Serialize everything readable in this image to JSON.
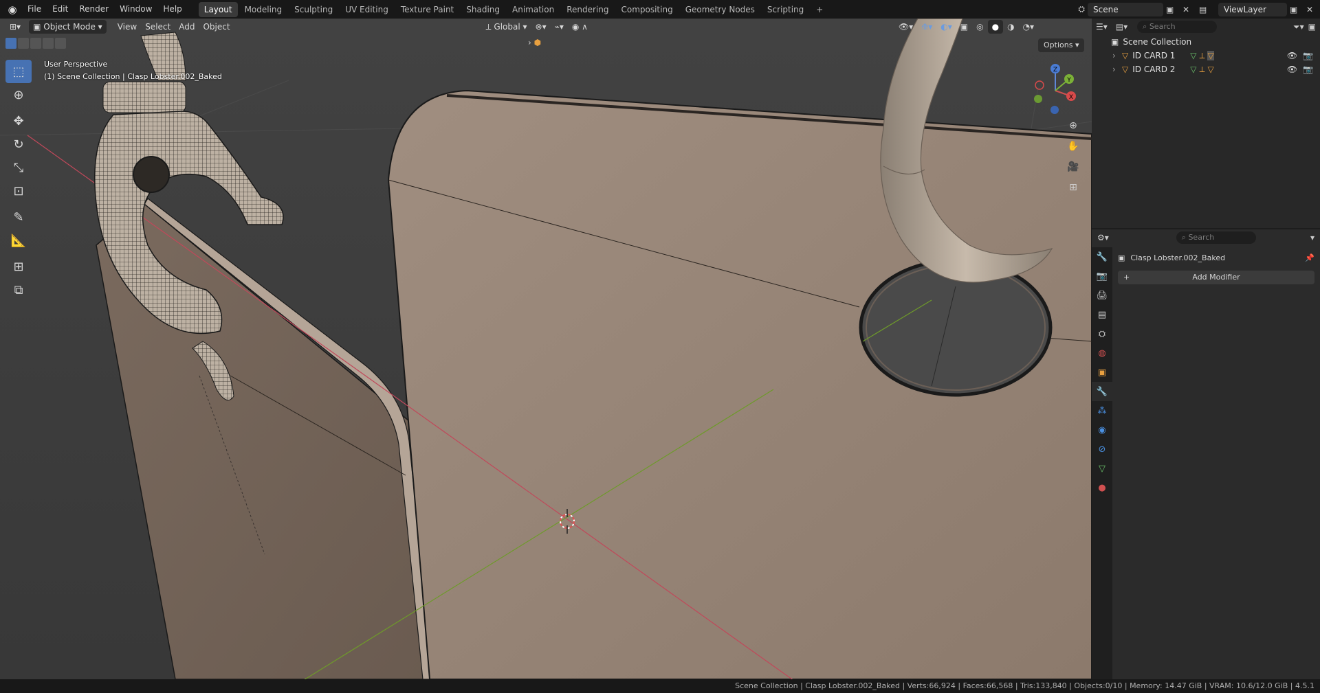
{
  "menu": [
    "File",
    "Edit",
    "Render",
    "Window",
    "Help"
  ],
  "workspaces": [
    "Layout",
    "Modeling",
    "Sculpting",
    "UV Editing",
    "Texture Paint",
    "Shading",
    "Animation",
    "Rendering",
    "Compositing",
    "Geometry Nodes",
    "Scripting"
  ],
  "active_workspace": "Layout",
  "scene_name": "Scene",
  "view_layer": "ViewLayer",
  "viewport": {
    "mode": "Object Mode",
    "menus": [
      "View",
      "Select",
      "Add",
      "Object"
    ],
    "transform_orientation": "Global",
    "perspective_label": "User Perspective",
    "context_label": "(1) Scene Collection | Clasp Lobster.002_Baked",
    "options_label": "Options",
    "axis_labels": {
      "x": "X",
      "y": "Y",
      "z": "Z"
    }
  },
  "outliner": {
    "search_placeholder": "Search",
    "root": "Scene Collection",
    "items": [
      {
        "label": "ID CARD 1"
      },
      {
        "label": "ID CARD 2"
      }
    ]
  },
  "properties": {
    "search_placeholder": "Search",
    "object_name": "Clasp Lobster.002_Baked",
    "add_modifier": "Add Modifier"
  },
  "status": {
    "collection": "Scene Collection",
    "object": "Clasp Lobster.002_Baked",
    "verts": "Verts:66,924",
    "faces": "Faces:66,568",
    "tris": "Tris:133,840",
    "objects": "Objects:0/10",
    "memory": "Memory: 14.47 GiB",
    "vram": "VRAM: 10.6/12.0 GiB",
    "version": "4.5.1"
  },
  "colors": {
    "accent": "#4772b3",
    "card": "#9c8a7c",
    "clasp": "#b8aa9a"
  }
}
